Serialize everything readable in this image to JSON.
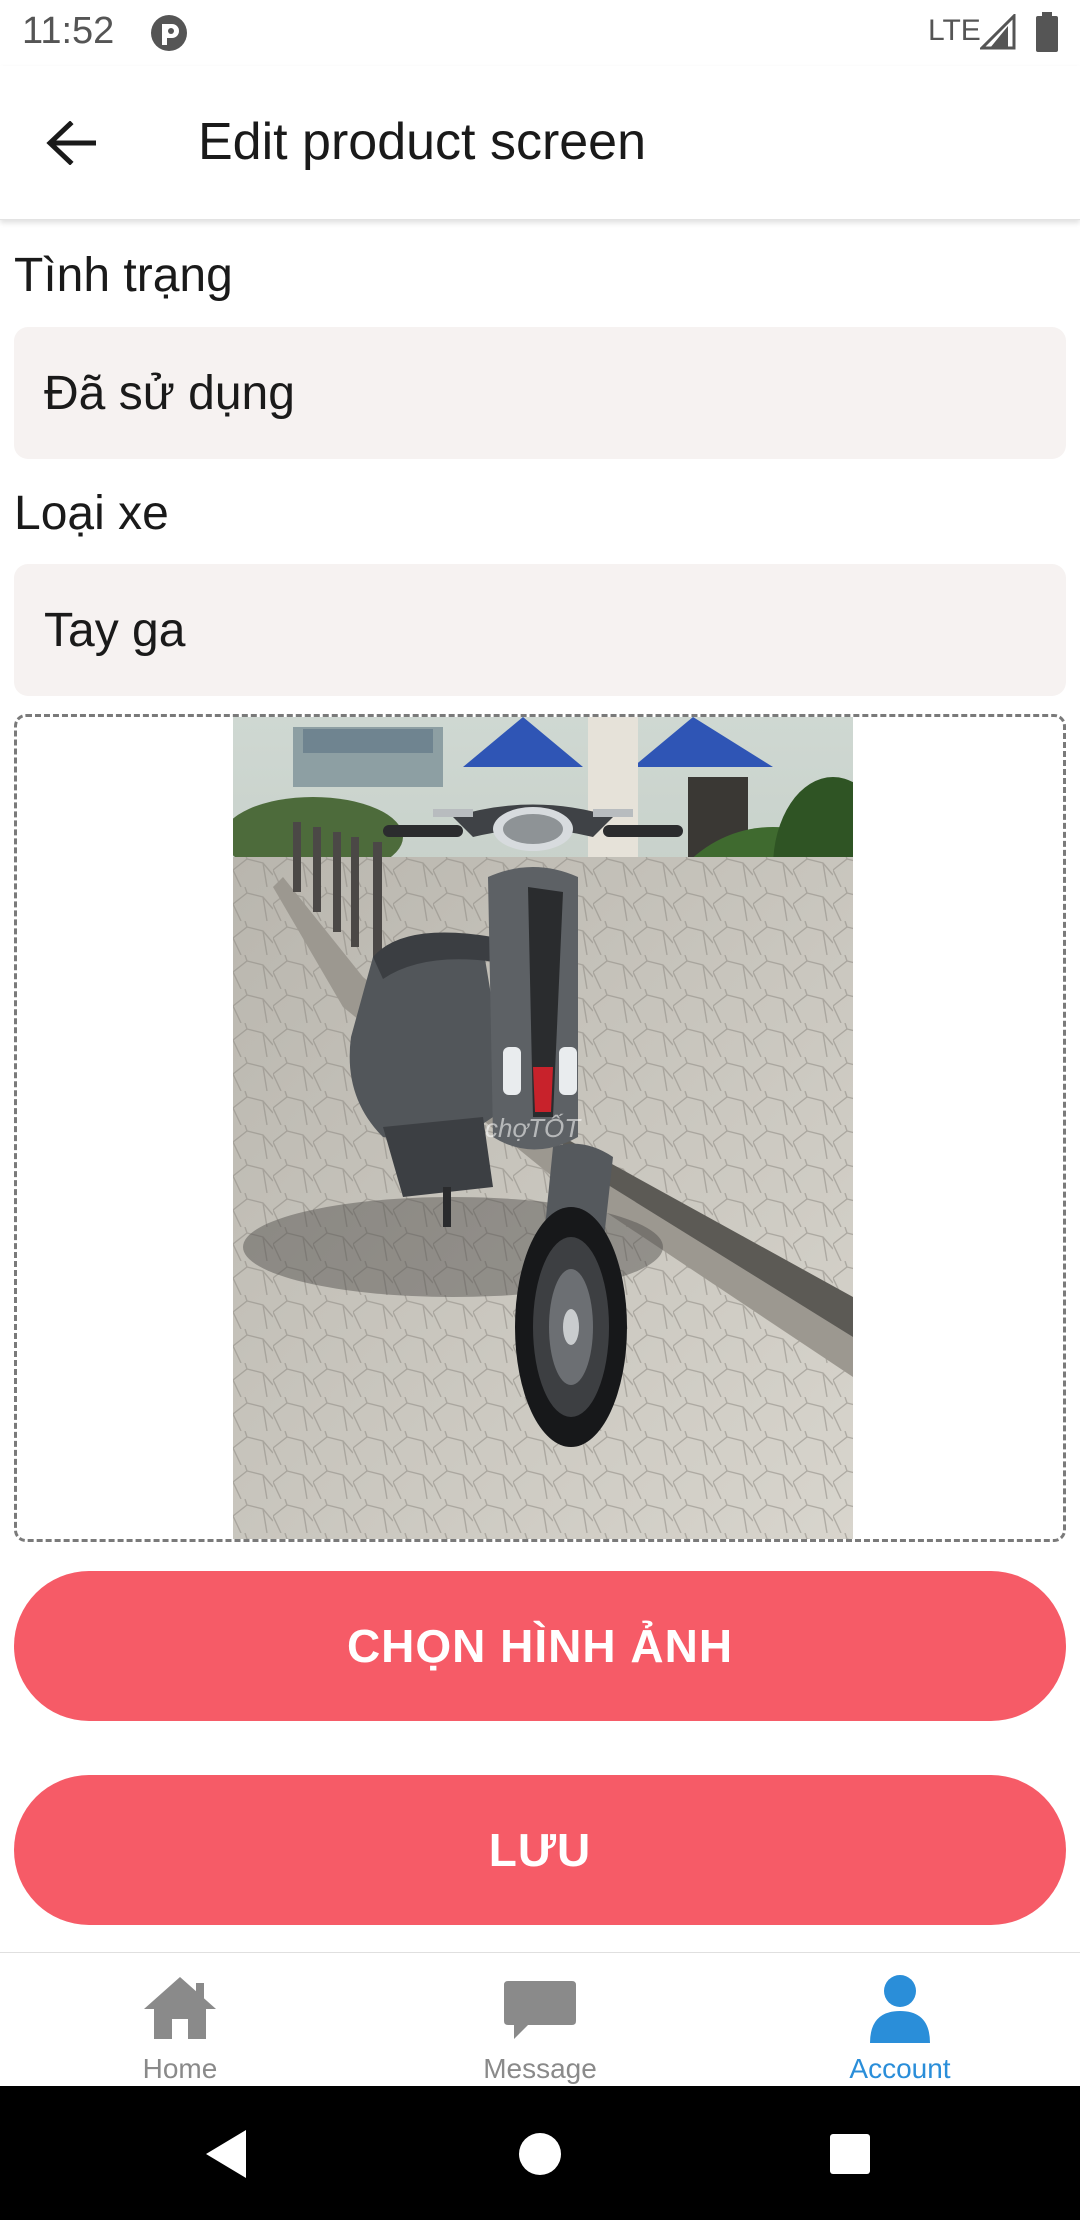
{
  "status_bar": {
    "time": "11:52",
    "network": "LTE",
    "icons": [
      "app-notification-icon",
      "signal-icon",
      "battery-icon"
    ]
  },
  "app_bar": {
    "title": "Edit product screen",
    "back_icon": "arrow-back-icon"
  },
  "form": {
    "condition": {
      "label": "Tình trạng",
      "value": "Đã sử dụng"
    },
    "vehicle_type": {
      "label": "Loại xe",
      "value": "Tay ga"
    },
    "image": {
      "watermark": "chợTỐT"
    }
  },
  "buttons": {
    "choose_image": "CHỌN HÌNH ẢNH",
    "save": "LƯU"
  },
  "bottom_nav": {
    "items": [
      {
        "label": "Home",
        "icon": "home-icon",
        "active": false
      },
      {
        "label": "Message",
        "icon": "message-icon",
        "active": false
      },
      {
        "label": "Account",
        "icon": "account-icon",
        "active": true
      }
    ]
  },
  "system_nav": {
    "icons": [
      "back-triangle-icon",
      "home-circle-icon",
      "recents-square-icon"
    ]
  },
  "colors": {
    "accent": "#f65b67",
    "active_nav": "#2a8ed9",
    "inactive_nav": "#8a8a8a",
    "field_background": "#f6f2f1"
  }
}
